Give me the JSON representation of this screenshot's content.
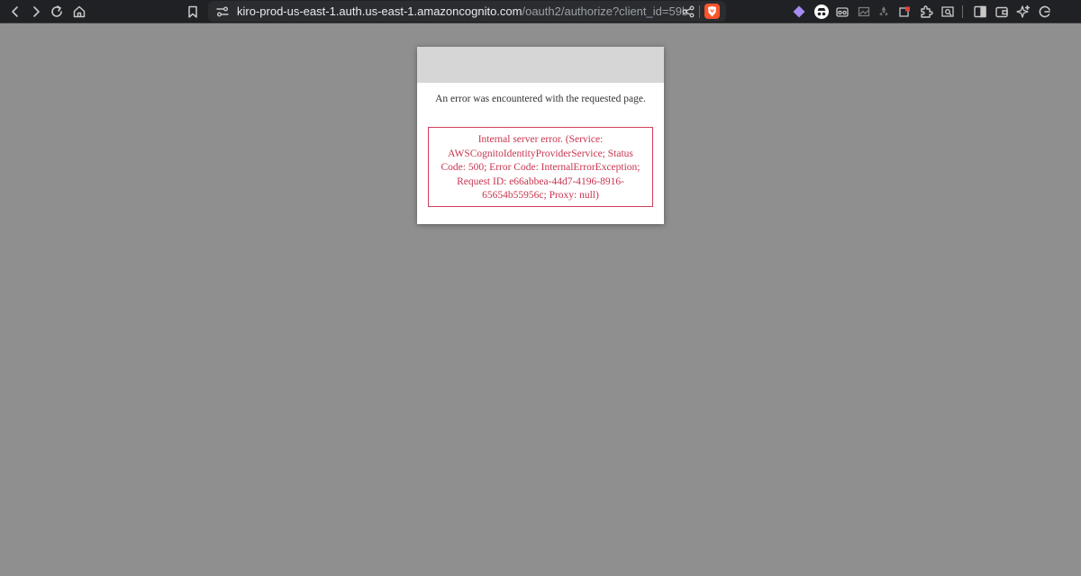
{
  "browser": {
    "url_host": "kiro-prod-us-east-1.auth.us-east-1.amazoncognito.com",
    "url_path": "/oauth2/authorize?client_id=59bd1...",
    "brave_color": "#fb542b"
  },
  "page": {
    "message": "An error was encountered with the requested page.",
    "error": "Internal server error. (Service: AWSCognitoIdentityProviderService; Status Code: 500; Error Code: InternalErrorException; Request ID: e66abbea-44d7-4196-8916-65654b55956c; Proxy: null)",
    "error_color": "#c8354f",
    "background_color": "#8f8f8f"
  }
}
